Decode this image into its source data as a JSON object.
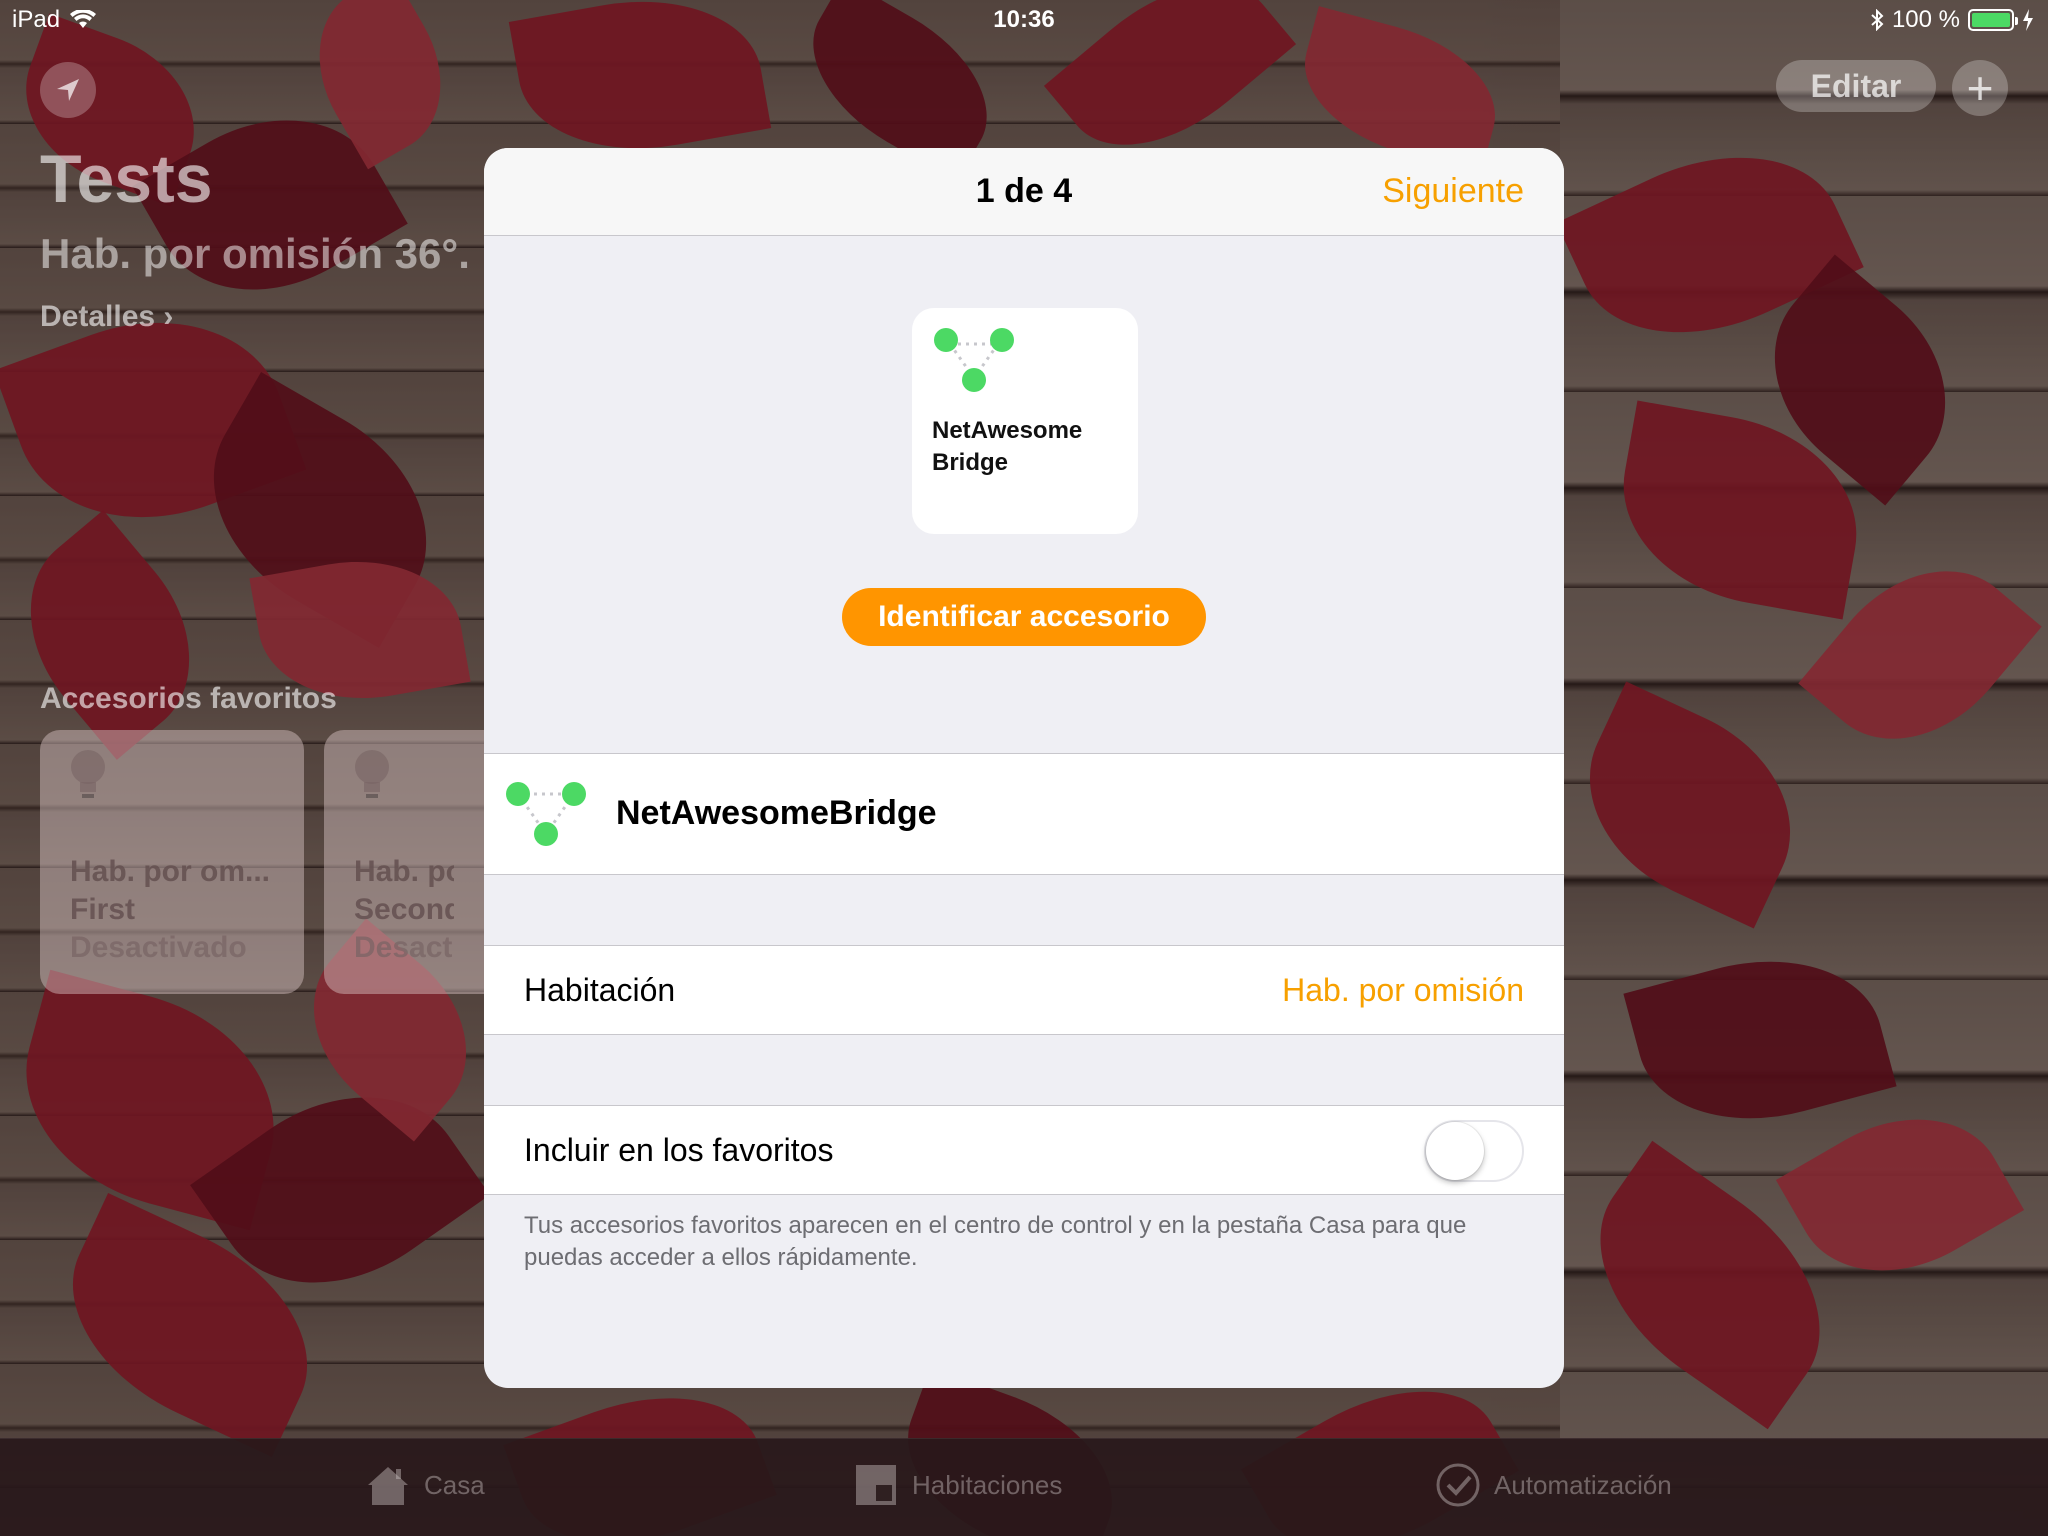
{
  "status_bar": {
    "device": "iPad",
    "time": "10:36",
    "battery": "100 %"
  },
  "home": {
    "title": "Tests",
    "subtitle": "Hab. por omisión 36°.",
    "details": "Detalles",
    "edit_label": "Editar",
    "add_label": "+",
    "favorites_header": "Accesorios favoritos",
    "tiles": [
      {
        "room": "Hab. por om...",
        "name": "First",
        "state": "Desactivado"
      },
      {
        "room": "Hab. por",
        "name": "Second",
        "state": "Desactiv"
      }
    ]
  },
  "tabbar": {
    "tabs": [
      {
        "label": "Casa",
        "icon": "house-icon"
      },
      {
        "label": "Habitaciones",
        "icon": "rooms-icon"
      },
      {
        "label": "Automatización",
        "icon": "automation-icon"
      }
    ]
  },
  "modal": {
    "title": "1 de 4",
    "next_label": "Siguiente",
    "accessory_card_name": "NetAwesome Bridge",
    "identify_label": "Identificar accesorio",
    "accessory_name": "NetAwesomeBridge",
    "room_label": "Habitación",
    "room_value": "Hab. por omisión",
    "favorites_label": "Incluir en los favoritos",
    "favorites_enabled": false,
    "footnote": "Tus accesorios favoritos aparecen en el centro de control y en la pestaña Casa para que puedas acceder a ellos rápidamente."
  },
  "colors": {
    "accent": "#ff9500",
    "link": "#f7a000",
    "bridge_dot": "#4cd964"
  }
}
